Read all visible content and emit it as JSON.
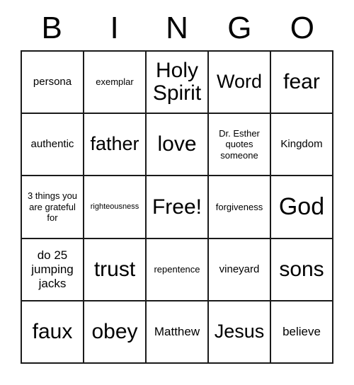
{
  "card": {
    "header_letters": [
      "B",
      "I",
      "N",
      "G",
      "O"
    ],
    "free_space_label": "Free!",
    "grid": [
      [
        {
          "text": "persona",
          "size": "md"
        },
        {
          "text": "exemplar",
          "size": "sm"
        },
        {
          "text": "Holy Spirit",
          "size": "3xl"
        },
        {
          "text": "Word",
          "size": "2xl"
        },
        {
          "text": "fear",
          "size": "3xl"
        }
      ],
      [
        {
          "text": "authentic",
          "size": "md"
        },
        {
          "text": "father",
          "size": "2xl"
        },
        {
          "text": "love",
          "size": "3xl"
        },
        {
          "text": "Dr. Esther quotes someone",
          "size": "sm"
        },
        {
          "text": "Kingdom",
          "size": "md"
        }
      ],
      [
        {
          "text": "3 things you are grateful for",
          "size": "sm"
        },
        {
          "text": "righteousness",
          "size": "xs"
        },
        {
          "text": "Free!",
          "size": "3xl"
        },
        {
          "text": "forgiveness",
          "size": "sm"
        },
        {
          "text": "God",
          "size": "4xl"
        }
      ],
      [
        {
          "text": "do 25 jumping jacks",
          "size": "lg"
        },
        {
          "text": "trust",
          "size": "3xl"
        },
        {
          "text": "repentence",
          "size": "sm"
        },
        {
          "text": "vineyard",
          "size": "md"
        },
        {
          "text": "sons",
          "size": "3xl"
        }
      ],
      [
        {
          "text": "faux",
          "size": "3xl"
        },
        {
          "text": "obey",
          "size": "3xl"
        },
        {
          "text": "Matthew",
          "size": "lg"
        },
        {
          "text": "Jesus",
          "size": "2xl"
        },
        {
          "text": "believe",
          "size": "lg"
        }
      ]
    ]
  }
}
